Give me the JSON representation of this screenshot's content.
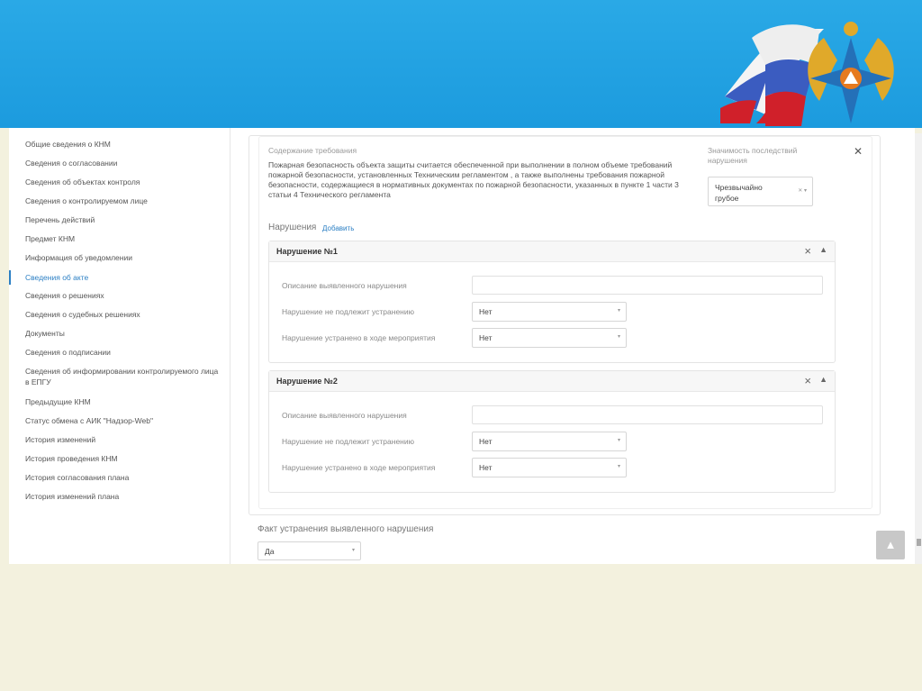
{
  "sidebar": {
    "items": [
      {
        "label": "Общие сведения о КНМ"
      },
      {
        "label": "Сведения о согласовании"
      },
      {
        "label": "Сведения об объектах контроля"
      },
      {
        "label": "Сведения о контролируемом лице"
      },
      {
        "label": "Перечень действий"
      },
      {
        "label": "Предмет КНМ"
      },
      {
        "label": "Информация об уведомлении"
      },
      {
        "label": "Сведения об акте",
        "active": true
      },
      {
        "label": "Сведения о решениях"
      },
      {
        "label": "Сведения о судебных решениях"
      },
      {
        "label": "Документы"
      },
      {
        "label": "Сведения о подписании"
      },
      {
        "label": "Сведения об информировании контролируемого лица в ЕПГУ"
      },
      {
        "label": "Предыдущие КНМ"
      },
      {
        "label": "Статус обмена с АИК \"Надзор-Web\""
      },
      {
        "label": "История изменений"
      },
      {
        "label": "История проведения КНМ"
      },
      {
        "label": "История согласования плана"
      },
      {
        "label": "История изменений плана"
      }
    ]
  },
  "requirement": {
    "label": "Содержание требования",
    "text": "Пожарная безопасность объекта защиты считается обеспеченной при выполнении в полном объеме требований пожарной безопасности, установленных Техническим регламентом , а также выполнены требования пожарной безопасности, содержащиеся в нормативных документах по пожарной безопасности, указанных в пункте 1 части 3 статьи 4 Технического регламента",
    "severity_label": "Значимость последствий нарушения",
    "severity_value": "Чрезвычайно грубое"
  },
  "violations": {
    "title": "Нарушения",
    "add_label": "Добавить",
    "items": [
      {
        "title": "Нарушение №1",
        "description_label": "Описание выявленного нарушения",
        "description_value": "",
        "not_subject_label": "Нарушение не подлежит устранению",
        "not_subject_value": "Нет",
        "eliminated_label": "Нарушение устранено в ходе мероприятия",
        "eliminated_value": "Нет"
      },
      {
        "title": "Нарушение №2",
        "description_label": "Описание выявленного нарушения",
        "description_value": "",
        "not_subject_label": "Нарушение не подлежит устранению",
        "not_subject_value": "Нет",
        "eliminated_label": "Нарушение устранено в ходе мероприятия",
        "eliminated_value": "Нет"
      }
    ]
  },
  "fact": {
    "label": "Факт устранения выявленного нарушения",
    "value": "Да"
  },
  "icons": {
    "close": "close-icon",
    "collapse": "chevron-up-icon",
    "dropdown": "caret-down-icon",
    "scroll_up": "arrow-up-icon"
  },
  "colors": {
    "header": "#1c9bde",
    "accent": "#2b7fc4",
    "page_bg": "#f3f1de"
  }
}
